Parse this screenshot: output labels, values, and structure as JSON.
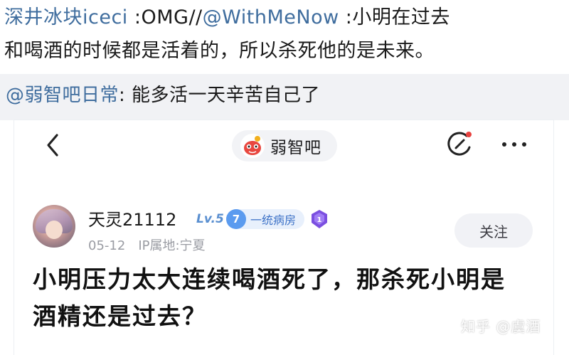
{
  "repost": {
    "author1": "深井冰块iceci",
    "sep1": " :OMG//",
    "author2": "@WithMeNow",
    "text_line1": " :小明在过去",
    "text_line2": "和喝酒的时候都是活着的，所以杀死他的是未来。"
  },
  "reply": {
    "author": "@弱智吧日常",
    "text": ": 能多活一天辛苦自己了"
  },
  "header": {
    "community": "弱智吧"
  },
  "post": {
    "username": "天灵21112",
    "level": "Lv.5",
    "group_number": "7",
    "group_name": "一统病房",
    "date": "05-12",
    "ip": "IP属地:宁夏",
    "follow_label": "关注",
    "title": "小明压力太大连续喝酒死了，那杀死小明是酒精还是过去？"
  },
  "watermark": "知乎 @虞酒",
  "colors": {
    "link": "#3f6d9e",
    "badge_blue": "#5b9bef",
    "edit_dot": "#e8423f"
  }
}
